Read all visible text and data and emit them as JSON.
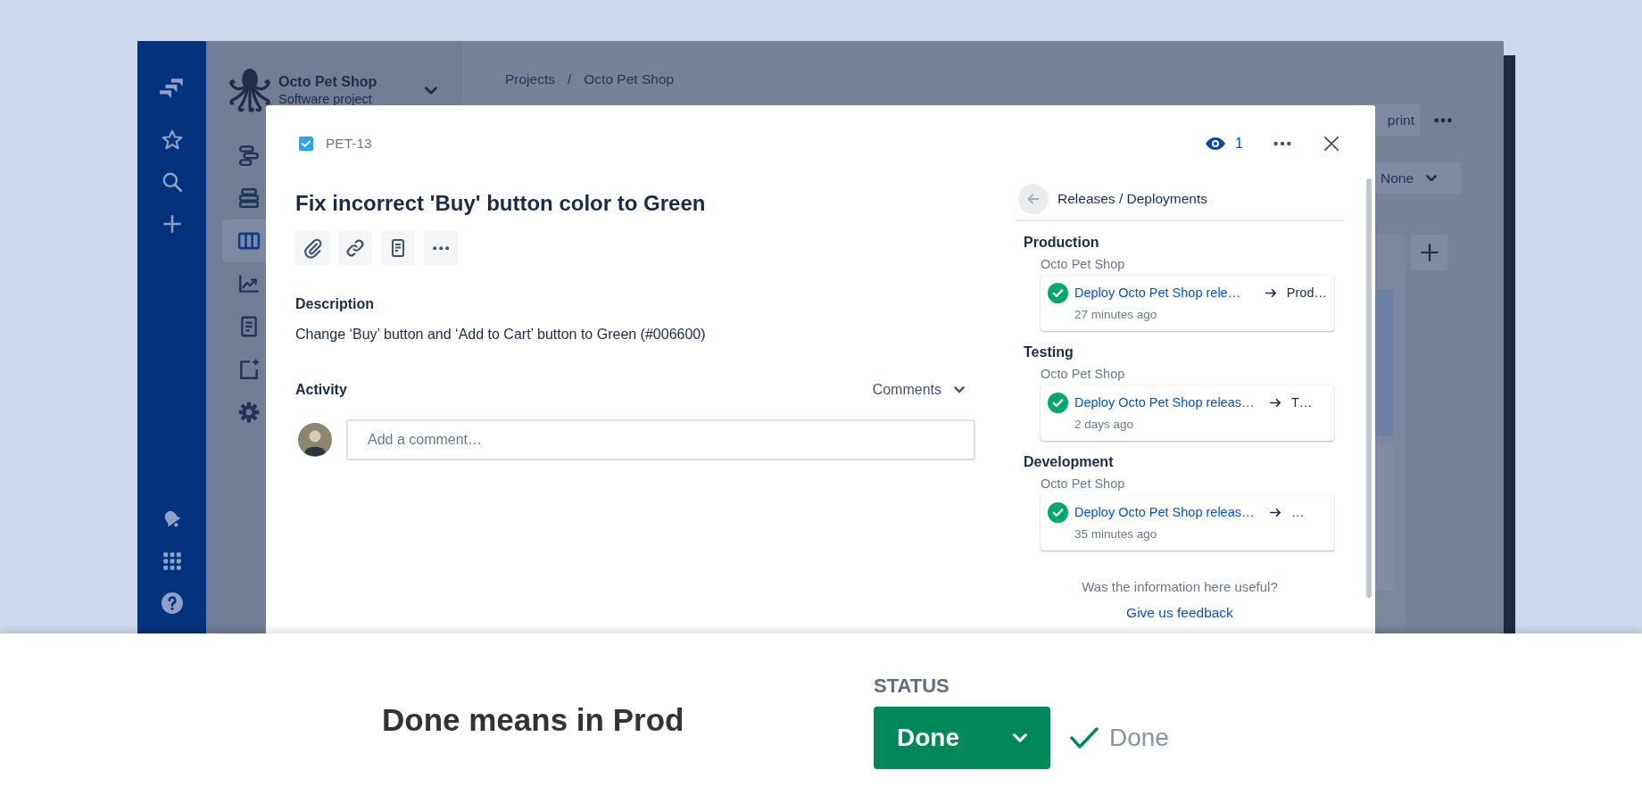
{
  "project": {
    "name": "Octo Pet Shop",
    "type": "Software project"
  },
  "project_nav": [
    {
      "kind": "roadmap",
      "selected": false
    },
    {
      "kind": "backlog",
      "selected": false
    },
    {
      "kind": "board",
      "selected": true
    },
    {
      "kind": "reports",
      "selected": false
    },
    {
      "kind": "pages",
      "selected": false
    },
    {
      "kind": "add-item",
      "selected": false
    },
    {
      "kind": "settings",
      "selected": false
    }
  ],
  "breadcrumbs": [
    "Projects",
    "Octo Pet Shop"
  ],
  "breadcrumb_separator": "/",
  "header_button": "print",
  "filter": {
    "value": "None"
  },
  "issue": {
    "key": "PET-13",
    "watchers": "1",
    "title": "Fix incorrect 'Buy' button color to Green",
    "description_label": "Description",
    "description": "Change ‘Buy’ button and ‘Add to Cart’ button to Green (#006600)",
    "activity_label": "Activity",
    "activity_filter": "Comments",
    "comment_placeholder": "Add a comment…"
  },
  "panel": {
    "title": "Releases / Deployments",
    "environments": [
      {
        "name": "Production",
        "project": "Octo Pet Shop",
        "deployment": {
          "name": "Deploy Octo Pet Shop rele…",
          "target": "Prod…",
          "time": "27 minutes ago",
          "successful": true
        }
      },
      {
        "name": "Testing",
        "project": "Octo Pet Shop",
        "deployment": {
          "name": "Deploy Octo Pet Shop releas…",
          "target": "T…",
          "time": "2 days ago",
          "successful": true
        }
      },
      {
        "name": "Development",
        "project": "Octo Pet Shop",
        "deployment": {
          "name": "Deploy Octo Pet Shop releas…",
          "target": "…",
          "time": "35 minutes ago",
          "successful": true
        }
      }
    ],
    "feedback_question": "Was the information here useful?",
    "feedback_link": "Give us feedback"
  },
  "caption": {
    "headline": "Done means in Prod",
    "status_label": "STATUS",
    "status_button": "Done",
    "resolution": "Done"
  }
}
